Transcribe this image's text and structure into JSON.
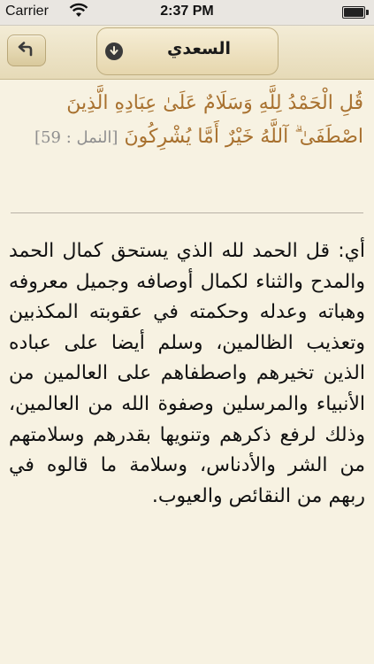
{
  "status": {
    "carrier": "Carrier",
    "time": "2:37 PM",
    "battery_level": 1.0
  },
  "nav": {
    "back_icon": "back-arrow-icon",
    "download_icon": "download-arrow-icon",
    "title": "السعدي"
  },
  "verse": {
    "text": "قُلِ الْحَمْدُ لِلَّهِ وَسَلَامٌ عَلَىٰ عِبَادِهِ الَّذِينَ اصْطَفَىٰ ۗ آللَّهُ خَيْرٌ أَمَّا يُشْرِكُونَ",
    "reference": "[النمل : 59]"
  },
  "tafsir": {
    "text": "أي: قل الحمد لله الذي يستحق كمال الحمد والمدح والثناء لكمال أوصافه وجميل معروفه وهباته وعدله وحكمته في عقوبته المكذبين وتعذيب الظالمين، وسلم أيضا على عباده الذين تخيرهم واصطفاهم على العالمين من الأنبياء والمرسلين وصفوة الله من العالمين، وذلك لرفع ذكرهم وتنويها بقدرهم وسلامتهم من الشر والأدناس، وسلامة ما قالوه في ربهم من النقائص والعيوب."
  }
}
